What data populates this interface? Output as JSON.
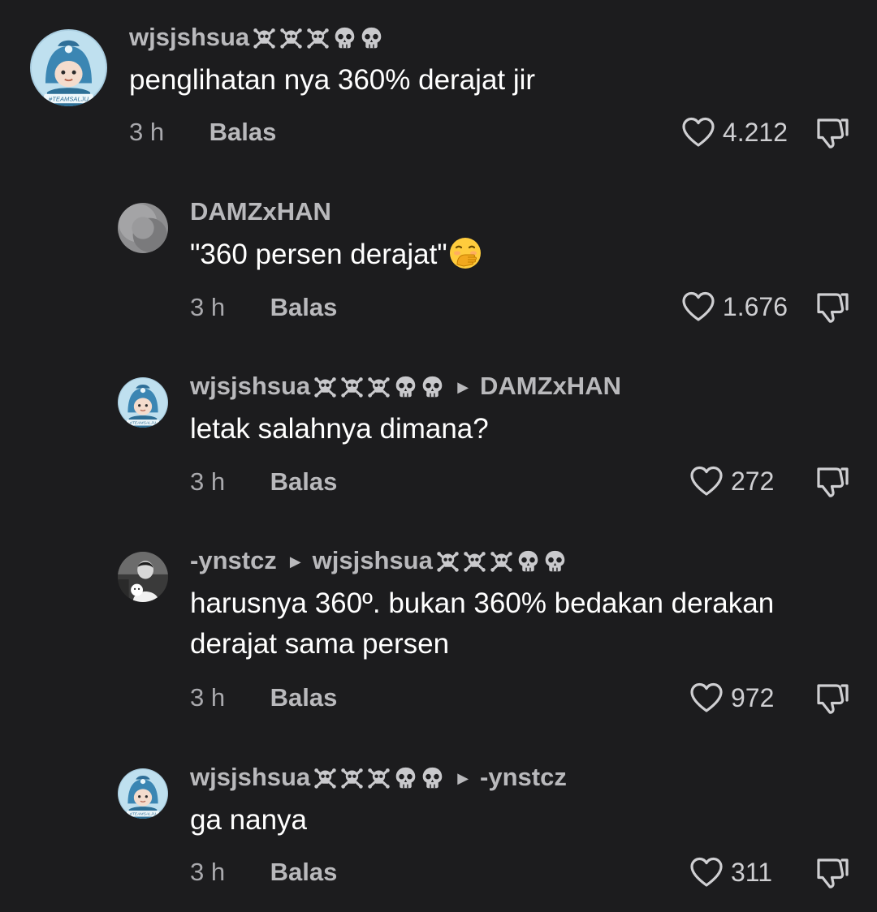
{
  "comments": [
    {
      "username": "wjsjshsua",
      "reply_to": "",
      "text": "penglihatan nya 360% derajat jir",
      "time": "3 h",
      "reply_label": "Balas",
      "likes": "4.212",
      "avatar_badge": "#TEAMSALJU"
    },
    {
      "username": "DAMZxHAN",
      "reply_to": "",
      "text": "\"360 persen derajat\"",
      "time": "3 h",
      "reply_label": "Balas",
      "likes": "1.676"
    },
    {
      "username": "wjsjshsua",
      "reply_to": "DAMZxHAN",
      "text": "letak salahnya dimana?",
      "time": "3 h",
      "reply_label": "Balas",
      "likes": "272",
      "avatar_badge": "#TEAMSALJU"
    },
    {
      "username": "-ynstcz",
      "reply_to": "wjsjshsua",
      "text_line1": "harusnya 360º. bukan 360% bedakan derakan",
      "text_line2": "derajat sama persen",
      "time": "3 h",
      "reply_label": "Balas",
      "likes": "972"
    },
    {
      "username": "wjsjshsua",
      "reply_to": "-ynstcz",
      "text": "ga nanya",
      "time": "3 h",
      "reply_label": "Balas",
      "likes": "311",
      "avatar_badge": "#TEAMSALJU"
    }
  ],
  "icons": {
    "username_emojis": [
      "skull-crossbones-icon",
      "skull-crossbones-icon",
      "skull-crossbones-icon",
      "skull-icon",
      "skull-icon"
    ],
    "like": "heart-outline-icon",
    "dislike": "thumbs-down-icon",
    "text_emoji": "face-with-hand-over-mouth-emoji"
  },
  "colors": {
    "background": "#1c1c1e",
    "username": "#b9b9bc",
    "text": "#ffffff",
    "meta": "#a9a9ad"
  }
}
